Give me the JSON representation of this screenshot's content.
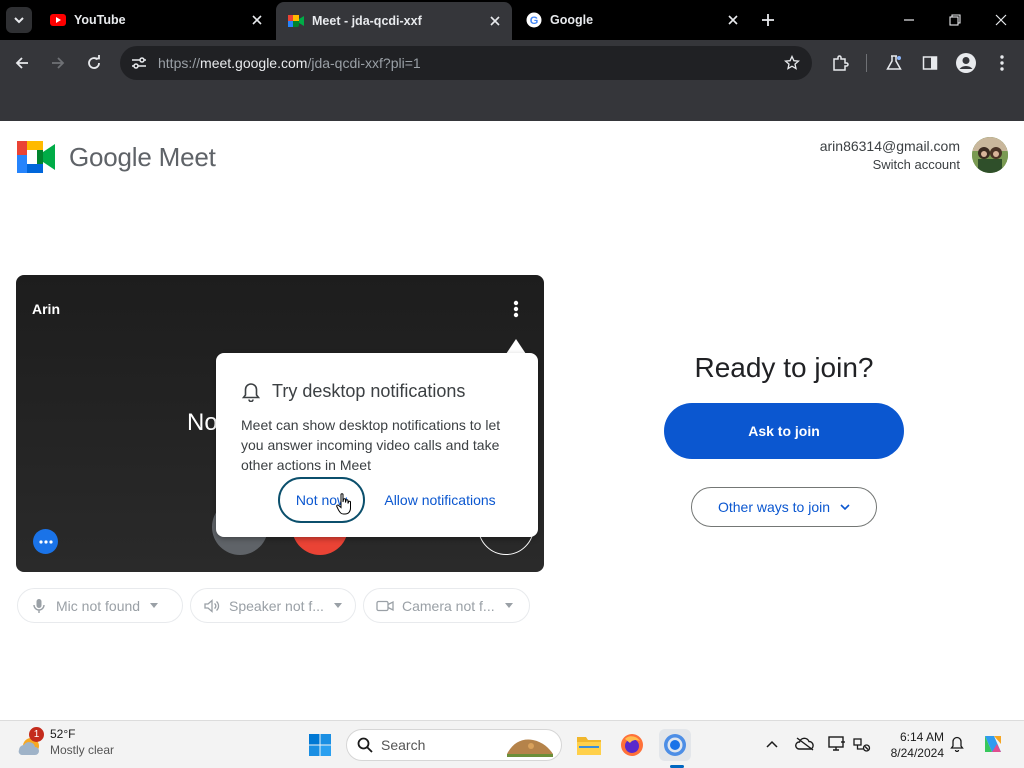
{
  "browser": {
    "tabs": [
      {
        "title": "YouTube",
        "icon": "youtube-icon",
        "active": false
      },
      {
        "title": "Meet - jda-qcdi-xxf",
        "icon": "meet-icon",
        "active": true
      },
      {
        "title": "Google",
        "icon": "google-icon",
        "active": false
      }
    ],
    "address": {
      "prefix": "https://",
      "host": "meet.google.com",
      "path": "/jda-qcdi-xxf?pli=1"
    }
  },
  "page": {
    "logo_text": "Google Meet",
    "account": {
      "email": "arin86314@gmail.com",
      "switch_label": "Switch account"
    },
    "preview": {
      "name": "Arin",
      "message_partial": "No"
    },
    "devices": [
      {
        "label": "Mic not found",
        "icon": "mic-icon"
      },
      {
        "label": "Speaker not f...",
        "icon": "speaker-icon"
      },
      {
        "label": "Camera not f...",
        "icon": "camera-icon"
      }
    ],
    "join": {
      "heading": "Ready to join?",
      "ask_label": "Ask to join",
      "other_label": "Other ways to join"
    },
    "notification_popup": {
      "title": "Try desktop notifications",
      "body": "Meet can show desktop notifications to let you answer incoming video calls and take other actions in Meet",
      "not_now_label": "Not now",
      "allow_label": "Allow notifications"
    }
  },
  "taskbar": {
    "weather": {
      "badge": "1",
      "temp": "52°F",
      "condition": "Mostly clear"
    },
    "search_label": "Search",
    "time": "6:14 AM",
    "date": "8/24/2024"
  },
  "colors": {
    "primary_blue": "#0b57d0",
    "chrome_dark": "#35363a",
    "page_bg": "#ffffff"
  }
}
